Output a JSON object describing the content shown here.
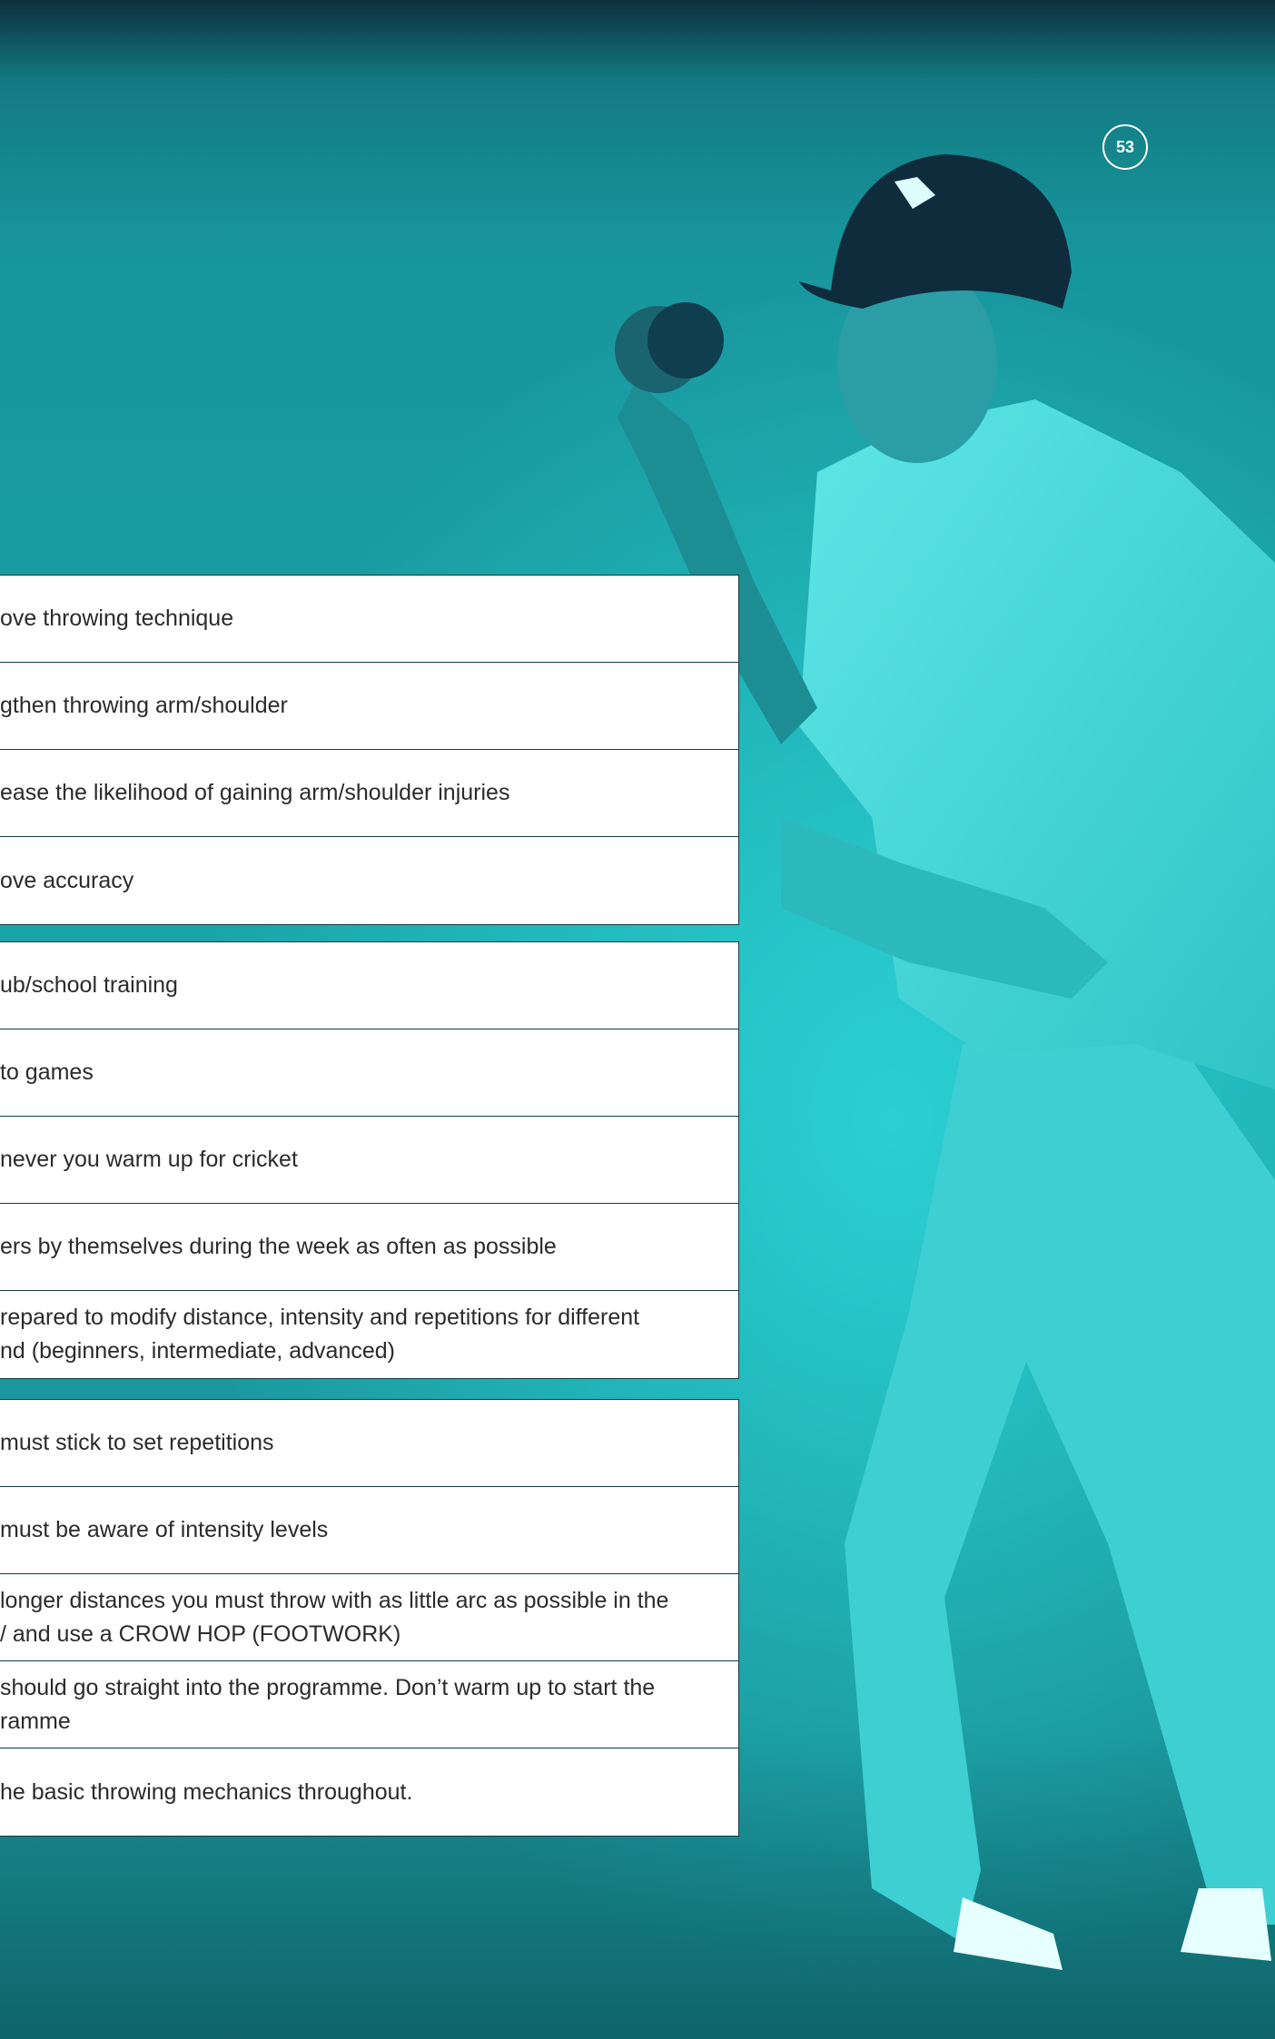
{
  "page": {
    "number": "53"
  },
  "colors": {
    "overlay": "#1ba6aa",
    "table_bg": "#ffffff",
    "table_border": "#123c48",
    "text": "#2b2b2b"
  },
  "aims": [
    "ove throwing technique",
    "gthen throwing arm/shoulder",
    "ease the likelihood of gaining arm/shoulder injuries",
    "ove accuracy"
  ],
  "when": [
    "ub/school training",
    "to games",
    "never you warm up for cricket",
    "ers by themselves during the week as often as possible",
    "repared to modify distance, intensity and repetitions for different\nnd (beginners, intermediate, advanced)"
  ],
  "rules": [
    "must stick to set repetitions",
    "must be aware of intensity levels",
    " longer distances you must throw with as little arc as possible in the\n/ and use a CROW HOP (FOOTWORK)",
    "should go straight into the programme. Don’t warm up to start the\nramme",
    "he basic throwing mechanics throughout."
  ]
}
